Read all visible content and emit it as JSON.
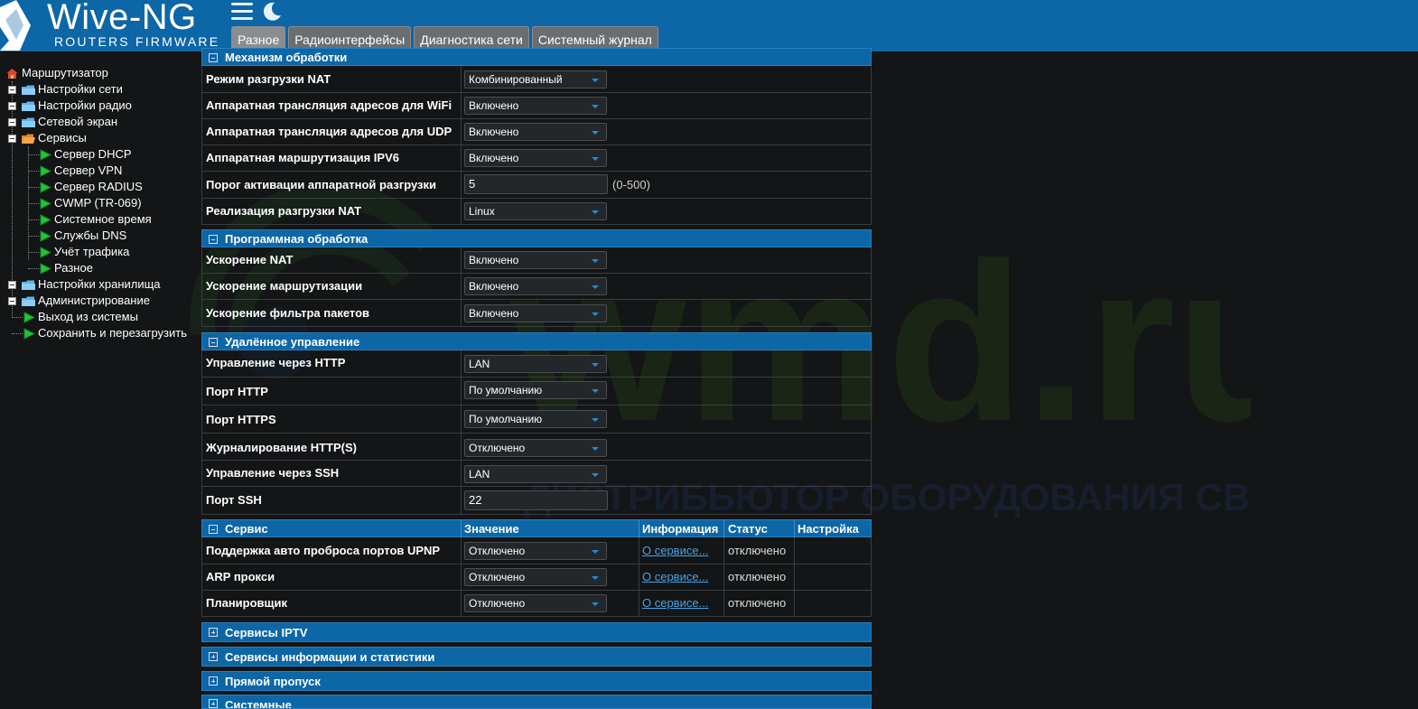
{
  "header": {
    "logo_title": "Wive-NG",
    "logo_subtitle": "ROUTERS FIRMWARE",
    "menu_icon": "hamburger-icon",
    "theme_icon": "moon-icon",
    "tabs": [
      "Разное",
      "Радиоинтерфейсы",
      "Диагностика сети",
      "Системный журнал"
    ],
    "active_tab": "Разное"
  },
  "sidebar": {
    "root": "Маршрутизатор",
    "items": [
      {
        "label": "Настройки сети"
      },
      {
        "label": "Настройки радио"
      },
      {
        "label": "Сетевой экран"
      },
      {
        "label": "Сервисы"
      },
      {
        "label": "Сервер DHCP"
      },
      {
        "label": "Сервер VPN"
      },
      {
        "label": "Сервер RADIUS"
      },
      {
        "label": "CWMP (TR-069)"
      },
      {
        "label": "Системное время"
      },
      {
        "label": "Службы DNS"
      },
      {
        "label": "Учёт трафика"
      },
      {
        "label": "Разное"
      },
      {
        "label": "Настройки хранилища"
      },
      {
        "label": "Администрирование"
      },
      {
        "label": "Выход из системы"
      },
      {
        "label": "Сохранить и перезагрузить"
      }
    ]
  },
  "watermark": {
    "text": "wmd.ru",
    "subtext": "ДИСТРИБЬЮТОР ОБОРУДОВАНИЯ СВЯЗИ"
  },
  "sections": {
    "nat": {
      "title": "Механизм обработки",
      "rows": [
        {
          "label": "Режим разгрузки NAT",
          "value": "Комбинированный"
        },
        {
          "label": "Аппаратная трансляция адресов для WiFi",
          "value": "Включено"
        },
        {
          "label": "Аппаратная трансляция адресов для UDP",
          "value": "Включено"
        },
        {
          "label": "Аппаратная маршрутизация IPV6",
          "value": "Включено"
        },
        {
          "label": "Порог активации аппаратной разгрузки",
          "value": "5",
          "hint": "(0-500)"
        },
        {
          "label": "Реализация разгрузки NAT",
          "value": "Linux"
        }
      ]
    },
    "software": {
      "title": "Программная обработка",
      "rows": [
        {
          "label": "Ускорение NAT",
          "value": "Включено"
        },
        {
          "label": "Ускорение маршрутизации",
          "value": "Включено"
        },
        {
          "label": "Ускорение фильтра пакетов",
          "value": "Включено"
        }
      ]
    },
    "remote": {
      "title": "Удалённое управление",
      "rows": [
        {
          "label": "Управление через HTTP",
          "value": "LAN"
        },
        {
          "label": "Порт HTTP",
          "value": "По умолчанию"
        },
        {
          "label": "Порт HTTPS",
          "value": "По умолчанию"
        },
        {
          "label": "Журналирование HTTP(S)",
          "value": "Отключено"
        },
        {
          "label": "Управление через SSH",
          "value": "LAN"
        },
        {
          "label": "Порт SSH",
          "value": "22"
        }
      ]
    },
    "services": {
      "title": "Сервис",
      "columns": [
        "Значение",
        "Информация",
        "Статус",
        "Настройка"
      ],
      "rows": [
        {
          "label": "Поддержка авто проброса портов UPNP",
          "value": "Отключено",
          "info": "О сервисе...",
          "status": "отключено"
        },
        {
          "label": "ARP прокси",
          "value": "Отключено",
          "info": "О сервисе...",
          "status": "отключено"
        },
        {
          "label": "Планировщик",
          "value": "Отключено",
          "info": "О сервисе...",
          "status": "отключено"
        }
      ]
    },
    "collapsed": [
      "Сервисы IPTV",
      "Сервисы информации и статистики",
      "Прямой пропуск",
      "Системные"
    ]
  },
  "colors": {
    "header_blue": "#0d66a6",
    "background": "#131516",
    "link": "#4aa3e8"
  }
}
